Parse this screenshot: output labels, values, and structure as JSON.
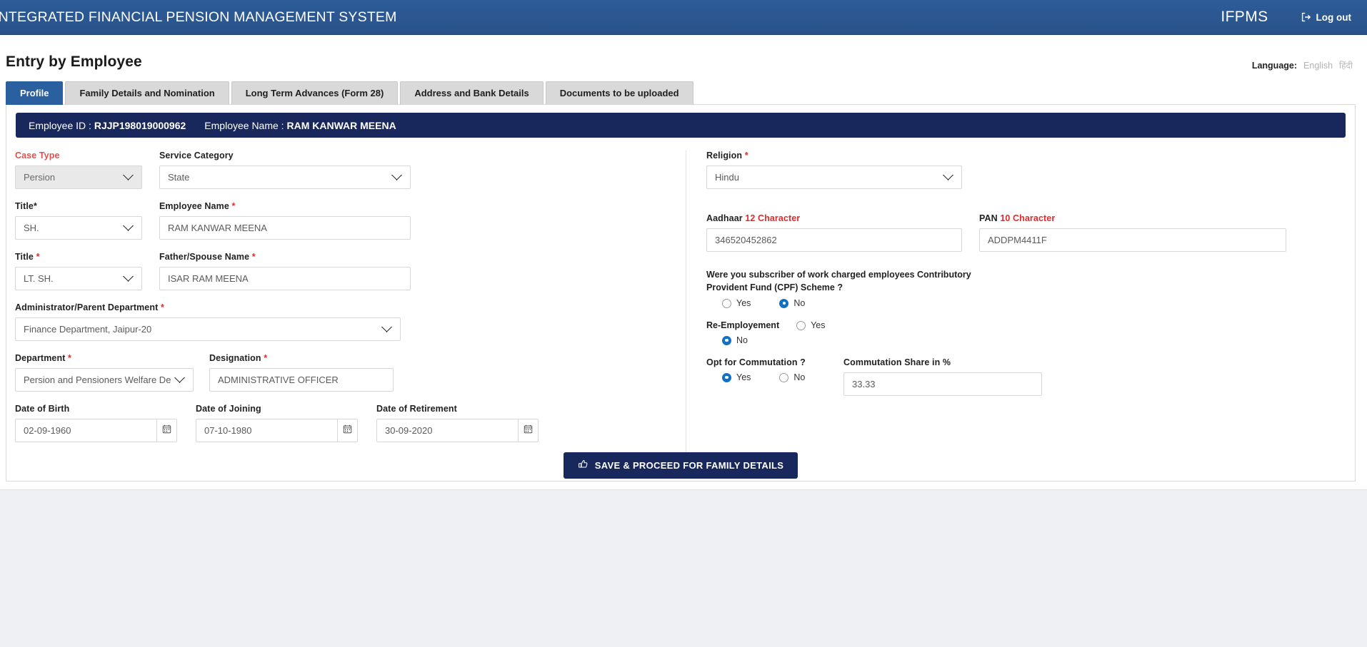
{
  "navbar": {
    "title": "INTEGRATED FINANCIAL PENSION MANAGEMENT SYSTEM",
    "brand": "IFPMS",
    "logout_label": "Log out",
    "logout_icon": "sign-out-icon",
    "bg_color": "#2a558c"
  },
  "page": {
    "title": "Entry by Employee",
    "language_label": "Language:",
    "language_english": "English",
    "language_hindi": "हिंदी"
  },
  "tabs": [
    {
      "label": "Profile",
      "active": true
    },
    {
      "label": "Family Details and Nomination",
      "active": false
    },
    {
      "label": "Long Term Advances (Form 28)",
      "active": false
    },
    {
      "label": "Address and Bank Details",
      "active": false
    },
    {
      "label": "Documents to be uploaded",
      "active": false
    }
  ],
  "employee_banner": {
    "id_label": "Employee ID :",
    "id_value": "RJJP198019000962",
    "name_label": "Employee Name :",
    "name_value": "RAM KANWAR MEENA",
    "bg_color": "#18285c"
  },
  "left_form": {
    "case_type_label": "Case Type",
    "case_type_value": "Persion",
    "service_category_label": "Service Category",
    "service_category_value": "State",
    "title1_label": "Title*",
    "title1_value": "SH.",
    "employee_name_label": "Employee Name",
    "employee_name_value": "RAM KANWAR MEENA",
    "title2_label": "Title",
    "title2_value": "LT. SH.",
    "father_spouse_label": "Father/Spouse Name",
    "father_spouse_value": "ISAR RAM MEENA",
    "parent_dept_label": "Administrator/Parent Department",
    "parent_dept_value": "Finance Department, Jaipur-20",
    "department_label": "Department",
    "department_value": "Persion and Pensioners Welfare Depart",
    "designation_label": "Designation",
    "designation_value": "ADMINISTRATIVE OFFICER",
    "dob_label": "Date of Birth",
    "dob_value": "02-09-1960",
    "doj_label": "Date of Joining",
    "doj_value": "07-10-1980",
    "dor_label": "Date of Retirement",
    "dor_value": "30-09-2020",
    "calendar_icon": "calendar-icon",
    "required_mark": "*"
  },
  "right_form": {
    "religion_label": "Religion",
    "religion_value": "Hindu",
    "aadhaar_label": "Aadhaar",
    "aadhaar_hint": "12 Character",
    "aadhaar_value": "346520452862",
    "pan_label": "PAN",
    "pan_hint": "10 Character",
    "pan_value": "ADDPM4411F",
    "cpf_question": "Were you subscriber of work charged employees Contributory Provident Fund (CPF) Scheme ?",
    "cpf_yes": "Yes",
    "cpf_no": "No",
    "cpf_selected": "No",
    "reemp_label": "Re-Employement",
    "reemp_yes": "Yes",
    "reemp_no": "No",
    "reemp_selected": "No",
    "commutation_label": "Opt for Commutation ?",
    "commutation_yes": "Yes",
    "commutation_no": "No",
    "commutation_selected": "Yes",
    "commutation_share_label": "Commutation Share in %",
    "commutation_share_value": "33.33",
    "required_mark": "*"
  },
  "actions": {
    "save_label": "SAVE & PROCEED FOR FAMILY DETAILS",
    "save_icon": "thumbs-up-icon",
    "save_bg": "#18285c"
  }
}
